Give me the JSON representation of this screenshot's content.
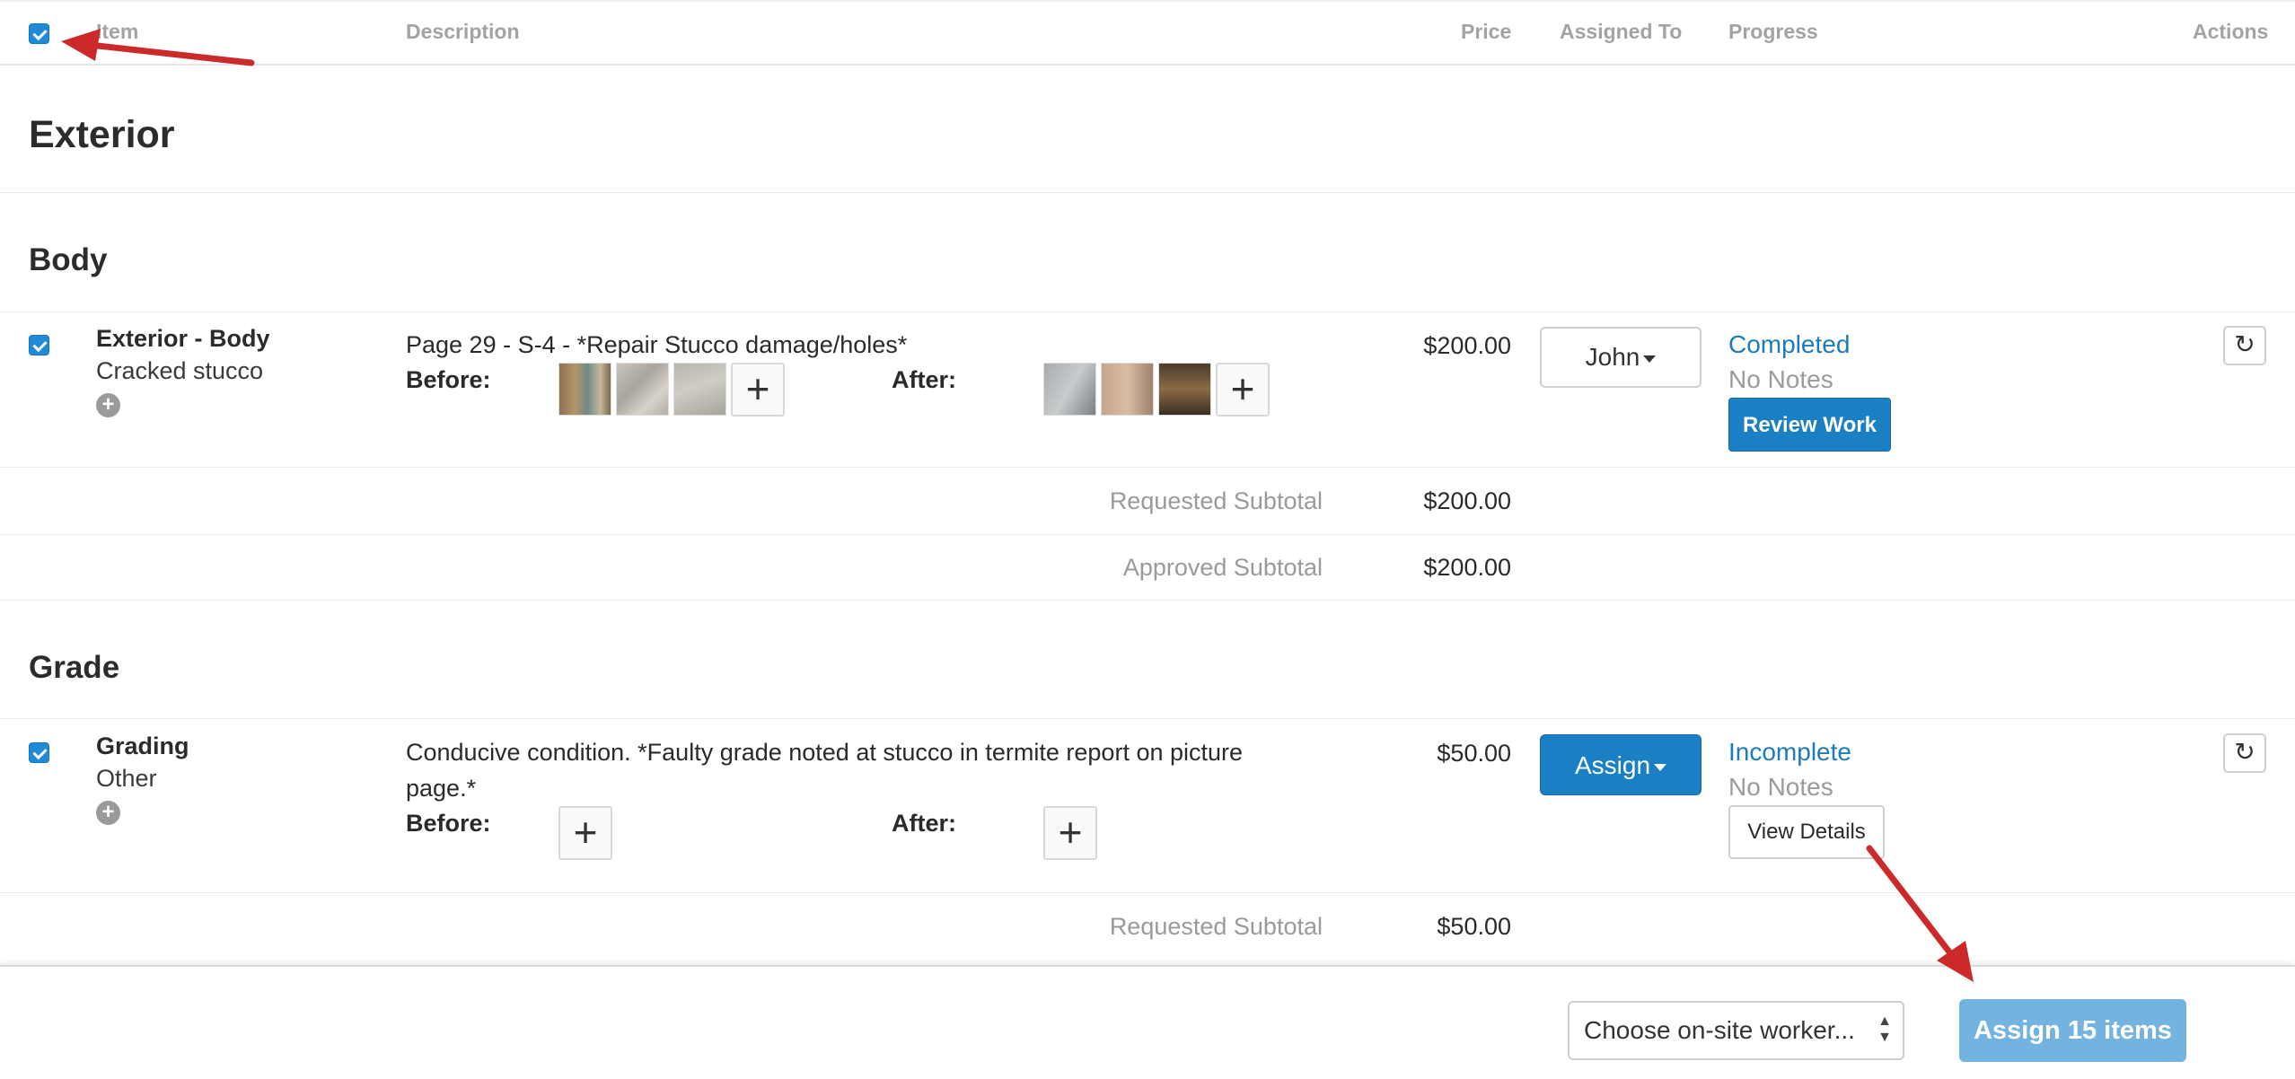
{
  "header": {
    "columns": {
      "item": "Item",
      "description": "Description",
      "price": "Price",
      "assigned_to": "Assigned To",
      "progress": "Progress",
      "actions": "Actions"
    },
    "select_all_checked": true
  },
  "section": {
    "title": "Exterior"
  },
  "groups": [
    {
      "title": "Body",
      "item": {
        "checked": true,
        "title": "Exterior - Body",
        "subtitle": "Cracked stucco",
        "description": "Page 29 - S-4 - *Repair Stucco damage/holes*",
        "before_label": "Before:",
        "after_label": "After:",
        "price": "$200.00",
        "assignee_button": "John",
        "status": "Completed",
        "notes": "No Notes",
        "action_button": "Review Work"
      },
      "subtotals": [
        {
          "label": "Requested Subtotal",
          "value": "$200.00"
        },
        {
          "label": "Approved Subtotal",
          "value": "$200.00"
        }
      ]
    },
    {
      "title": "Grade",
      "item": {
        "checked": true,
        "title": "Grading",
        "subtitle": "Other",
        "description_line1": "Conducive condition. *Faulty grade noted at stucco in termite report on picture",
        "description_line2": "page.*",
        "before_label": "Before:",
        "after_label": "After:",
        "price": "$50.00",
        "assignee_button": "Assign",
        "status": "Incomplete",
        "notes": "No Notes",
        "action_button": "View Details"
      },
      "subtotals": [
        {
          "label": "Requested Subtotal",
          "value": "$50.00"
        }
      ]
    }
  ],
  "footer": {
    "worker_select": "Choose on-site worker...",
    "assign_button": "Assign 15 items"
  },
  "colors": {
    "accent_blue": "#1a7fc4",
    "assign_disabled_blue": "#74b3e0",
    "link_blue": "#1c7bb8",
    "annotation_red": "#cc2a2a"
  }
}
